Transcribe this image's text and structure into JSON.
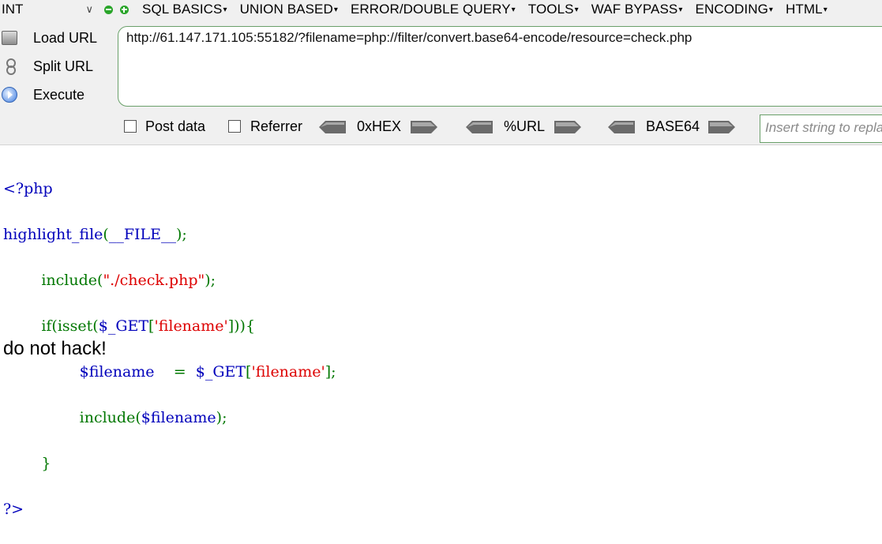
{
  "toolbar": {
    "select": {
      "value": "INT"
    },
    "menu": [
      {
        "label": "SQL BASICS"
      },
      {
        "label": "UNION BASED"
      },
      {
        "label": "ERROR/DOUBLE QUERY"
      },
      {
        "label": "TOOLS"
      },
      {
        "label": "WAF BYPASS"
      },
      {
        "label": "ENCODING"
      },
      {
        "label": "HTML"
      }
    ],
    "actions": {
      "load_url": "Load URL",
      "split_url": "Split URL",
      "execute": "Execute"
    },
    "url": "http://61.147.171.105:55182/?filename=php://filter/convert.base64-encode/resource=check.php",
    "options": {
      "post_data": "Post data",
      "referrer": "Referrer",
      "hex": "0xHEX",
      "url_enc": "%URL",
      "base64": "BASE64",
      "insert_placeholder": "Insert string to replace"
    }
  },
  "code": {
    "l1": "<?php",
    "l2_func": "highlight_file",
    "l2_paren_open": "(",
    "l2_arg": "__FILE__",
    "l2_end": ");",
    "l3_indent": "        ",
    "l3_func": "include",
    "l3_paren_open": "(",
    "l3_str": "\"./check.php\"",
    "l3_end": ");",
    "l4_indent": "        ",
    "l4_func": "if(isset(",
    "l4_var": "$_GET",
    "l4_br_open": "[",
    "l4_str": "'filename'",
    "l4_end": "])){",
    "l5_indent": "                ",
    "l5_var": "$filename",
    "l5_eq": "    =  ",
    "l5_get": "$_GET",
    "l5_br_open": "[",
    "l5_str": "'filename'",
    "l5_end": "];",
    "l6_indent": "                ",
    "l6_func": "include(",
    "l6_var": "$filename",
    "l6_end": ");",
    "l7_indent": "        ",
    "l7_brace": "}",
    "l8": "?>"
  },
  "output": {
    "message": "do not hack!"
  },
  "colors": {
    "keyword_green": "#007700",
    "default_blue": "#0000bb",
    "string_red": "#dd0000",
    "border_green": "#6aa06a"
  }
}
